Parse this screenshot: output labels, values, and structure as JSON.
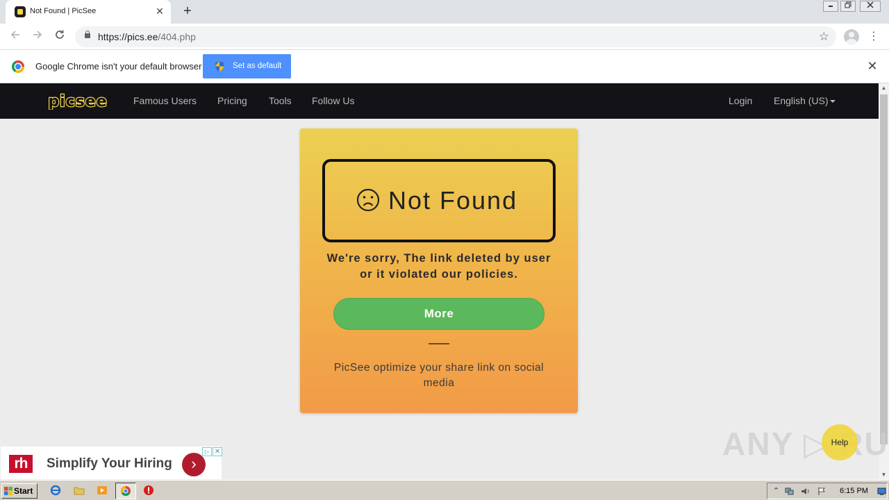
{
  "browser": {
    "tab_title": "Not Found | PicSee",
    "tab_close": "✕",
    "new_tab": "+",
    "url_host": "https://pics.ee",
    "url_path": "/404.php",
    "window_controls": [
      "minimize",
      "restore",
      "close"
    ]
  },
  "infobar": {
    "message": "Google Chrome isn't your default browser",
    "button": "Set as default",
    "close": "✕"
  },
  "site_nav": {
    "logo_text": "picsee",
    "links": [
      "Famous Users",
      "Pricing",
      "Tools",
      "Follow Us"
    ],
    "login": "Login",
    "language": "English (US)"
  },
  "error_card": {
    "heading": "Not Found",
    "message_line1": "We're sorry, The link deleted by user",
    "message_line2": "or it violated our policies.",
    "button": "More",
    "tagline": "PicSee optimize your share link on social media"
  },
  "ad": {
    "brand_mark": "rh",
    "headline": "Simplify Your Hiring",
    "arrow": "›",
    "adchoices": "▷",
    "close": "✕"
  },
  "overlay": {
    "watermark": "ANY ▷ RUN",
    "help": "Help"
  },
  "taskbar": {
    "start": "Start",
    "clock": "6:15 PM"
  },
  "colors": {
    "nav_bg": "#121217",
    "logo_yellow": "#f5d84a",
    "card_top": "#ecd052",
    "card_bottom": "#f29a48",
    "more_green": "#5cb85c",
    "chrome_blue": "#4d90fe"
  },
  "icons": [
    "picsee-favicon",
    "back-icon",
    "forward-icon",
    "reload-icon",
    "lock-icon",
    "star-icon",
    "profile-icon",
    "menu-icon",
    "chrome-logo-icon",
    "shield-icon",
    "close-icon",
    "frown-icon",
    "caret-down-icon",
    "start-flag-icon",
    "ie-icon",
    "folder-icon",
    "media-player-icon",
    "chrome-icon",
    "stop-icon",
    "tray-up-icon",
    "network-icon",
    "volume-icon",
    "flag-icon",
    "desktop-icon"
  ]
}
